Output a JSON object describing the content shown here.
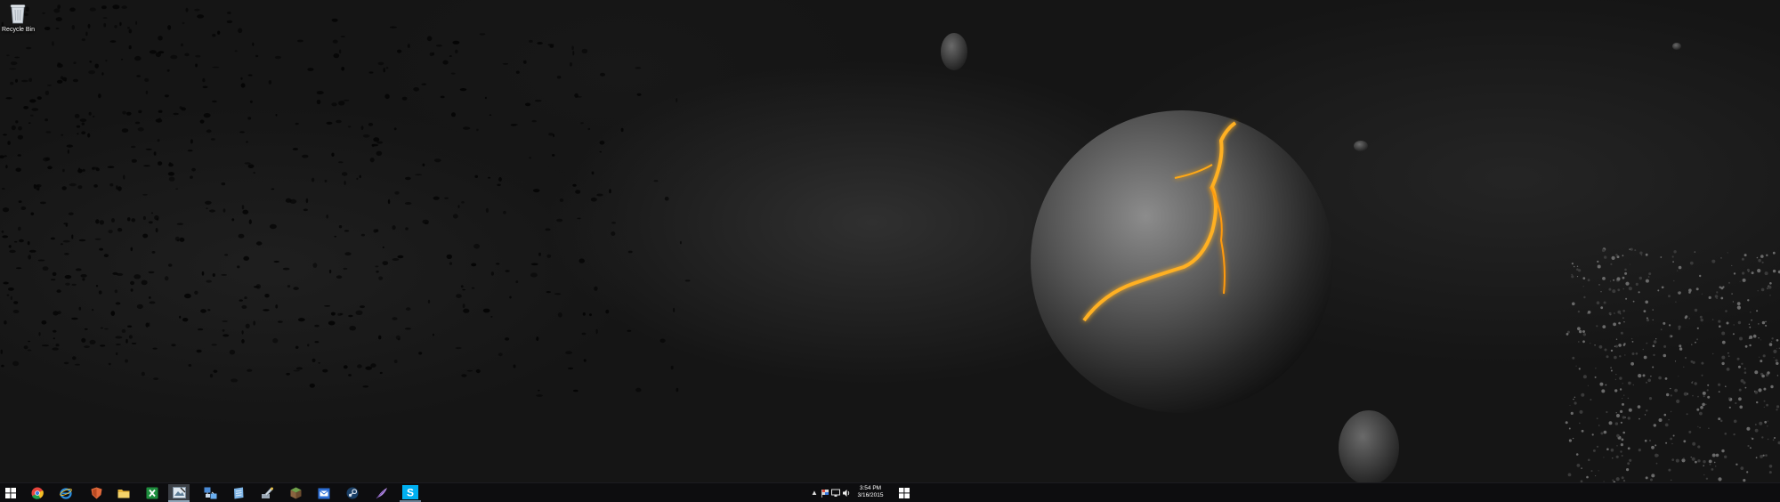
{
  "desktop": {
    "icons": [
      {
        "label": "Recycle Bin",
        "icon": "recycle-bin-icon"
      }
    ]
  },
  "taskbar": {
    "start": {
      "icon": "windows-logo-icon"
    },
    "pinned": [
      {
        "name": "chrome",
        "icon": "chrome-icon",
        "color": "#e8453c"
      },
      {
        "name": "internet-explorer",
        "icon": "internet-explorer-icon",
        "color": "#2b8ee0"
      },
      {
        "name": "brave-shield",
        "icon": "shield-icon",
        "color": "#e0683a"
      },
      {
        "name": "file-explorer",
        "icon": "folder-icon",
        "color": "#f2c94c"
      },
      {
        "name": "excel",
        "icon": "excel-icon",
        "color": "#1e8e3e"
      },
      {
        "name": "photo-editor",
        "icon": "photo-icon",
        "color": "#9ab0c4",
        "state": "active"
      },
      {
        "name": "network-app",
        "icon": "network-icon",
        "color": "#4a8bd6"
      },
      {
        "name": "notepad",
        "icon": "notepad-icon",
        "color": "#7db4e6"
      },
      {
        "name": "tools",
        "icon": "tools-icon",
        "color": "#aab4c0"
      },
      {
        "name": "minecraft",
        "icon": "minecraft-icon",
        "color": "#6fa04a"
      },
      {
        "name": "mail",
        "icon": "mail-icon",
        "color": "#2d6fd6"
      },
      {
        "name": "steam",
        "icon": "steam-icon",
        "color": "#c9d4df"
      },
      {
        "name": "feather-app",
        "icon": "feather-icon",
        "color": "#b48ce6"
      },
      {
        "name": "skype",
        "icon": "skype-icon",
        "color": "#00aff0",
        "state": "running"
      }
    ],
    "tray": {
      "chevron": "▲",
      "icons": [
        "flag-icon",
        "monitor-icon",
        "speaker-icon"
      ],
      "time": "3:54 PM",
      "date": "3/16/2015",
      "action_icon": "windows-logo-icon"
    }
  }
}
